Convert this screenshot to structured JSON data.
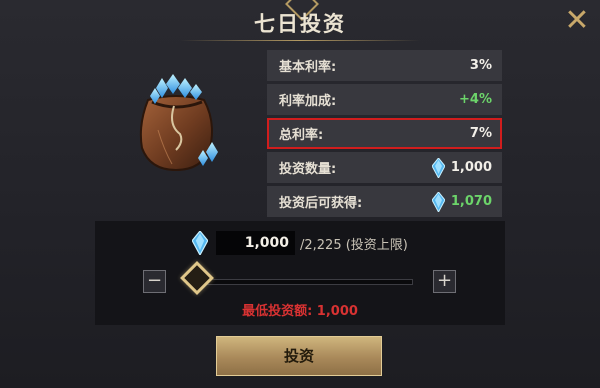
{
  "dialog": {
    "title": "七日投资",
    "close_glyph": "✕"
  },
  "stats": [
    {
      "label": "基本利率:",
      "value": "3%",
      "highlight": false,
      "color": "#f2efe8"
    },
    {
      "label": "利率加成:",
      "value": "+4%",
      "highlight": false,
      "color": "#6cd46a"
    },
    {
      "label": "总利率:",
      "value": "7%",
      "highlight": true,
      "color": "#f2efe8"
    },
    {
      "label": "投资数量:",
      "value": "1,000",
      "icon": "diamond-icon",
      "color": "#f2efe8"
    },
    {
      "label": "投资后可获得:",
      "value": "1,070",
      "icon": "diamond-icon",
      "color": "#6cd46a"
    }
  ],
  "invest": {
    "amount": "1,000",
    "limit_text": "/2,225 (投资上限)",
    "minus_glyph": "−",
    "plus_glyph": "+",
    "slider_fraction": 0.05,
    "min_text": "最低投资额: 1,000"
  },
  "button": {
    "label": "投资"
  },
  "colors": {
    "accent_gold": "#c8a86a",
    "highlight_border": "#d11d1d",
    "green": "#6cd46a",
    "warning_red": "#d83232"
  }
}
